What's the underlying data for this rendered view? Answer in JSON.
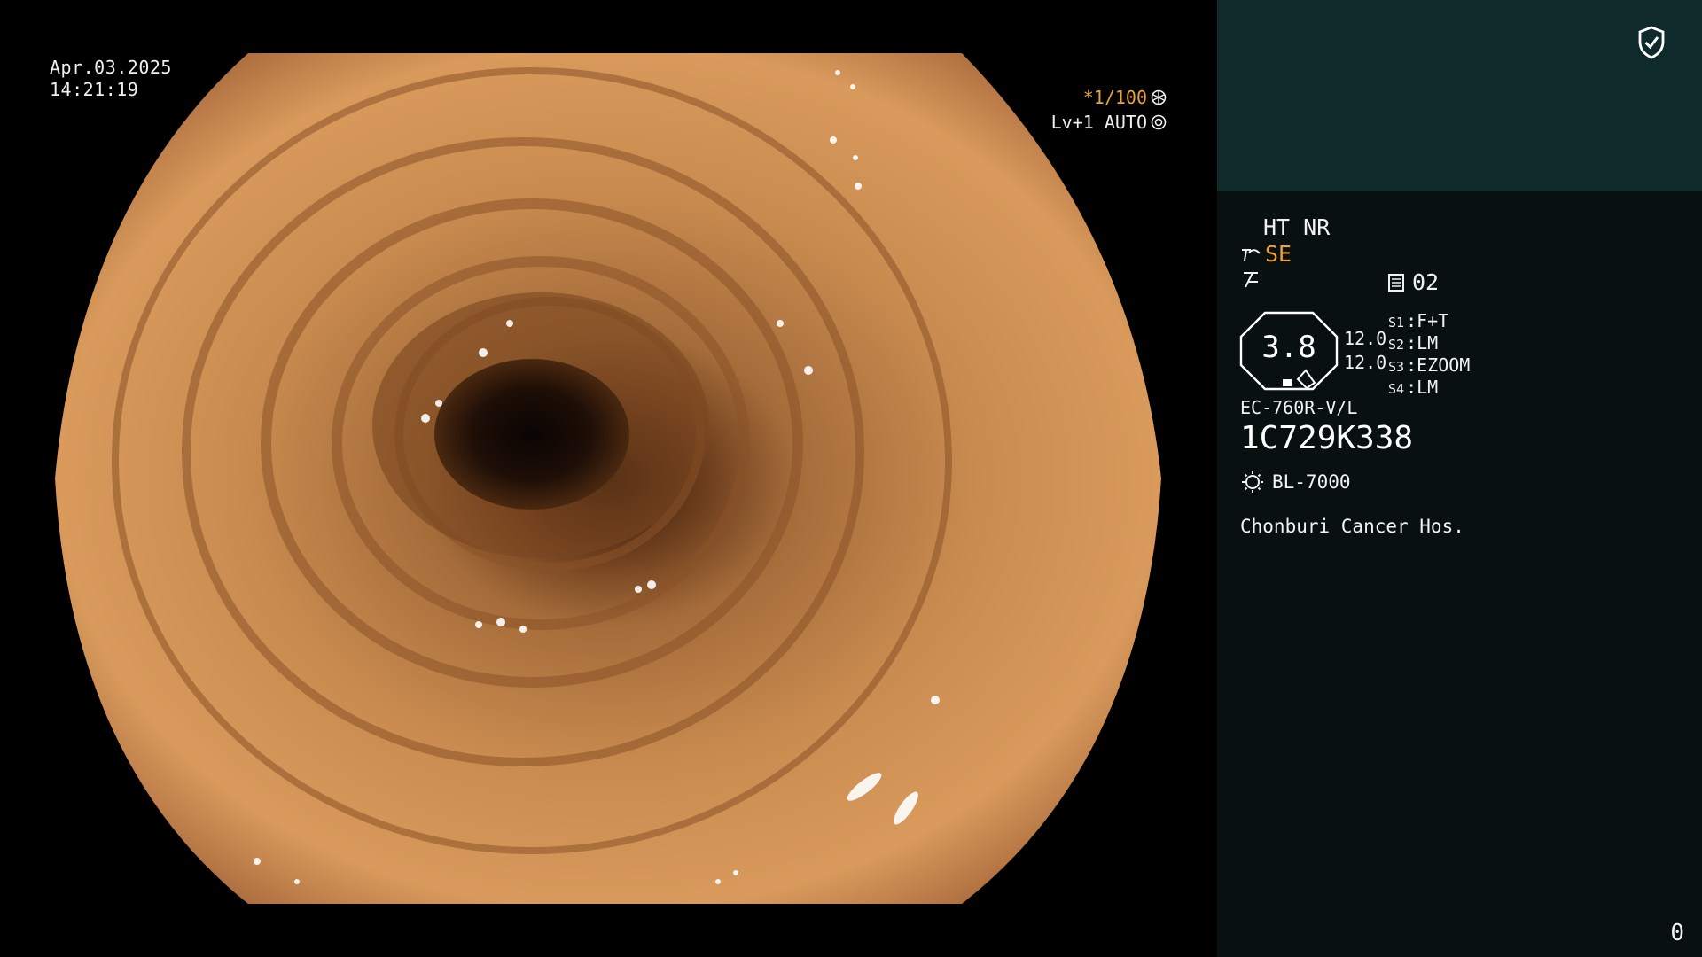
{
  "video": {
    "date": "Apr.03.2025",
    "time": "14:21:19",
    "shutter": "*1/100",
    "level": "Lv+1 AUTO"
  },
  "panel": {
    "ht_nr": "HT NR",
    "se": "SE",
    "memory": "02",
    "zoom_value": "3.8",
    "values": [
      "12.0",
      "12.0"
    ],
    "switches": [
      {
        "key": "S1",
        "value": "F+T"
      },
      {
        "key": "S2",
        "value": "LM"
      },
      {
        "key": "S3",
        "value": "EZOOM"
      },
      {
        "key": "S4",
        "value": "LM"
      }
    ],
    "scope_model": "EC-760R-V/L",
    "scope_serial": "1C729K338",
    "light_source": "BL-7000",
    "hospital": "Chonburi Cancer Hos.",
    "counter": "0"
  },
  "colors": {
    "accent": "#f0a030",
    "panel_top": "#0f2a2a",
    "panel_bg": "#081010"
  }
}
